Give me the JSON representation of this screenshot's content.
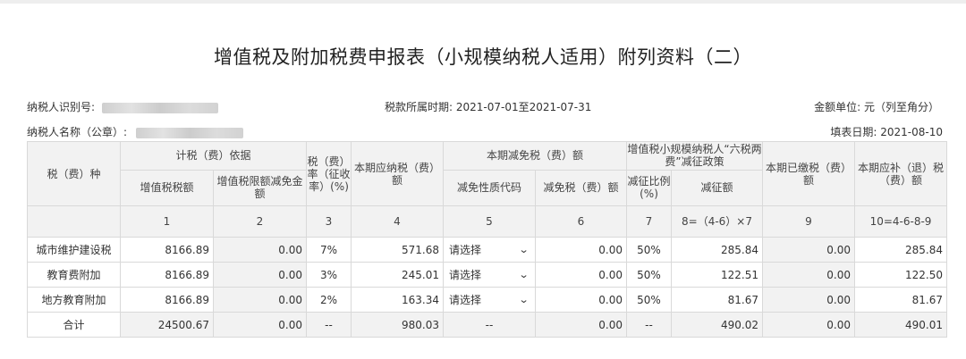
{
  "title": "增值税及附加税费申报表（小规模纳税人适用）附列资料（二）",
  "meta": {
    "taxpayer_id_label": "纳税人识别号:",
    "taxpayer_name_label": "纳税人名称（公章）:",
    "period": "税款所属时期: 2021-07-01至2021-07-31",
    "unit": "金额单位: 元（列至角分）",
    "fill_date": "填表日期: 2021-08-10"
  },
  "headers": {
    "tax_type": "税（费）种",
    "basis": "计税（费）依据",
    "vat_amount": "增值税税额",
    "vat_limit_reduction": "增值税限额减免金额",
    "rate": "税（费）率（征收率）(%)",
    "payable": "本期应纳税（费）额",
    "relief": "本期减免税（费）额",
    "relief_code": "减免性质代码",
    "relief_amount": "减免税（费）额",
    "six_tax": "增值税小规模纳税人“六税两费”减征政策",
    "reduction_ratio": "减征比例(%)",
    "reduction_amount": "减征额",
    "paid": "本期已缴税（费）额",
    "refund": "本期应补（退）税（费）额"
  },
  "col_numbers": [
    "1",
    "2",
    "3",
    "4",
    "5",
    "6",
    "7",
    "8=（4-6）×7",
    "9",
    "10=4-6-8-9"
  ],
  "rows": [
    {
      "name": "城市维护建设税",
      "vat": "8166.89",
      "limit": "0.00",
      "rate": "7%",
      "payable": "571.68",
      "code": "请选择",
      "relief": "0.00",
      "ratio": "50%",
      "reduction": "285.84",
      "paid": "0.00",
      "refund": "285.84"
    },
    {
      "name": "教育费附加",
      "vat": "8166.89",
      "limit": "0.00",
      "rate": "3%",
      "payable": "245.01",
      "code": "请选择",
      "relief": "0.00",
      "ratio": "50%",
      "reduction": "122.51",
      "paid": "0.00",
      "refund": "122.50"
    },
    {
      "name": "地方教育附加",
      "vat": "8166.89",
      "limit": "0.00",
      "rate": "2%",
      "payable": "163.34",
      "code": "请选择",
      "relief": "0.00",
      "ratio": "50%",
      "reduction": "81.67",
      "paid": "0.00",
      "refund": "81.67"
    }
  ],
  "total": {
    "name": "合计",
    "vat": "24500.67",
    "limit": "0.00",
    "rate": "--",
    "payable": "980.03",
    "code": "--",
    "relief": "0.00",
    "ratio": "--",
    "reduction": "490.02",
    "paid": "0.00",
    "refund": "490.01"
  },
  "icons": {
    "select_arrow": "chevron-down-icon"
  }
}
